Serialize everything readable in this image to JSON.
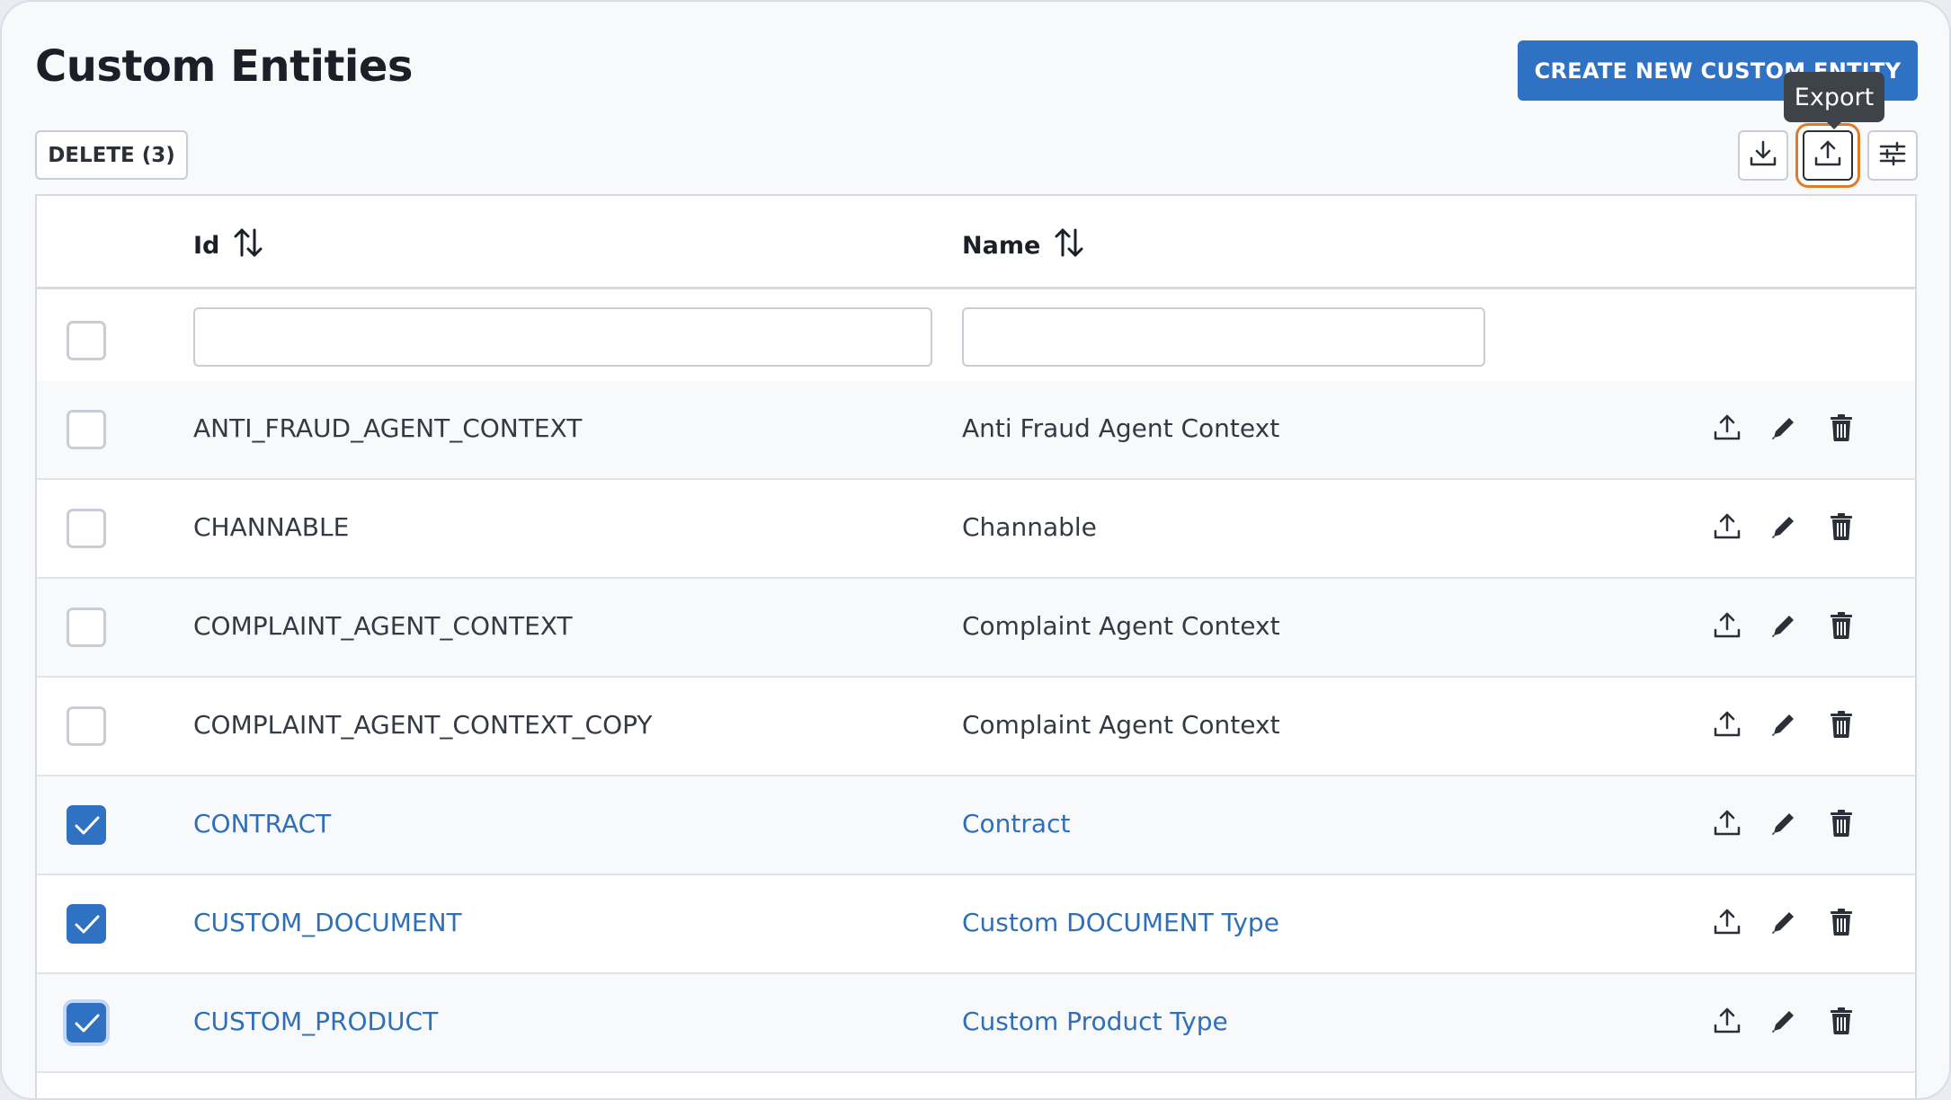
{
  "page": {
    "title": "Custom Entities"
  },
  "toolbar": {
    "create_label": "CREATE NEW CUSTOM ENTITY",
    "delete_label": "DELETE (3)",
    "import_icon": "download-icon",
    "export_icon": "upload-icon",
    "settings_icon": "sliders-icon",
    "tooltip": "Export"
  },
  "table": {
    "columns": [
      {
        "label": "Id",
        "sortable": true
      },
      {
        "label": "Name",
        "sortable": true
      }
    ],
    "filters": {
      "id_value": "",
      "name_value": ""
    },
    "rows": [
      {
        "id": "ANTI_FRAUD_AGENT_CONTEXT",
        "name": "Anti Fraud Agent Context",
        "checked": false
      },
      {
        "id": "CHANNABLE",
        "name": "Channable",
        "checked": false
      },
      {
        "id": "COMPLAINT_AGENT_CONTEXT",
        "name": "Complaint Agent Context",
        "checked": false
      },
      {
        "id": "COMPLAINT_AGENT_CONTEXT_COPY",
        "name": "Complaint Agent Context",
        "checked": false
      },
      {
        "id": "CONTRACT",
        "name": "Contract",
        "checked": true
      },
      {
        "id": "CUSTOM_DOCUMENT",
        "name": "Custom DOCUMENT Type",
        "checked": true
      },
      {
        "id": "CUSTOM_PRODUCT",
        "name": "Custom Product Type",
        "checked": true
      }
    ]
  },
  "colors": {
    "accent": "#2f72c4",
    "focus_ring": "#e07b2c",
    "link": "#2f6fb8"
  }
}
